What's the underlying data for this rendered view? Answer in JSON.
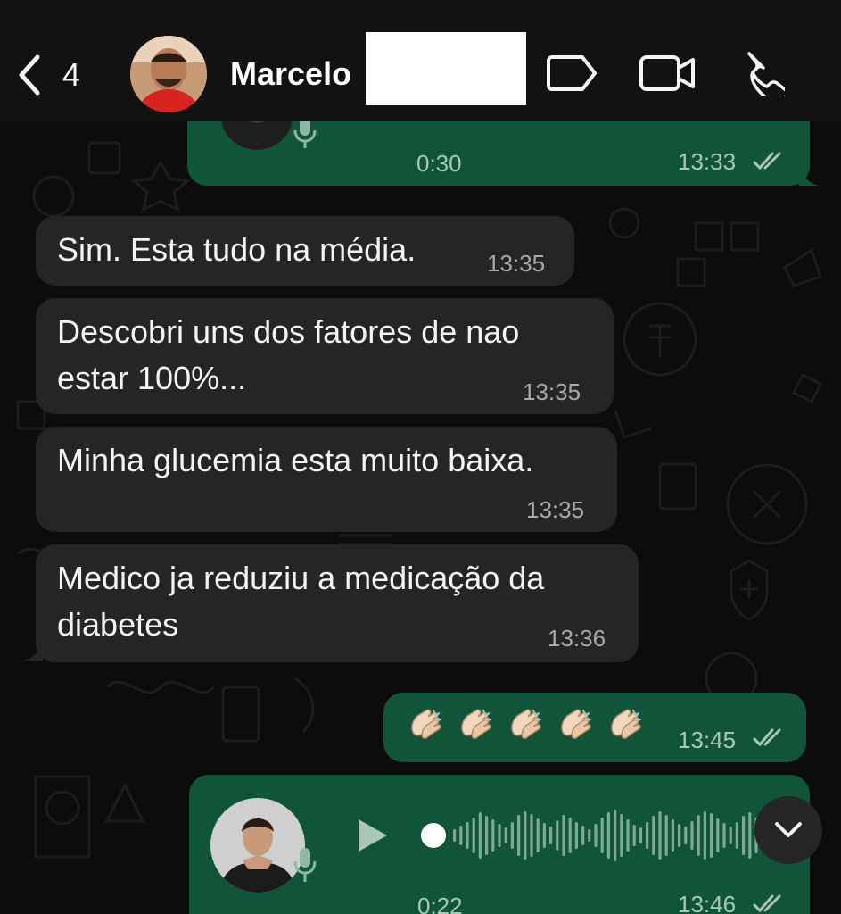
{
  "header": {
    "back_count": "4",
    "contact_name": "Marcelo",
    "icons": [
      "back-chevron-icon",
      "label-icon",
      "video-call-icon",
      "voice-call-icon"
    ]
  },
  "messages": [
    {
      "id": "voice-top",
      "direction": "outgoing",
      "type": "voice",
      "duration": "0:30",
      "time": "13:33",
      "status": "read"
    },
    {
      "id": "m1",
      "direction": "incoming",
      "type": "text",
      "lines": [
        "Sim. Esta tudo na média."
      ],
      "time": "13:35"
    },
    {
      "id": "m2",
      "direction": "incoming",
      "type": "text",
      "lines": [
        "Descobri uns dos fatores de nao",
        "estar 100%..."
      ],
      "time": "13:35"
    },
    {
      "id": "m3",
      "direction": "incoming",
      "type": "text",
      "lines": [
        "Minha glucemia esta muito baixa."
      ],
      "time": "13:35"
    },
    {
      "id": "m4",
      "direction": "incoming",
      "type": "text",
      "lines": [
        "Medico ja reduziu a medicação da",
        "diabetes"
      ],
      "time": "13:36"
    },
    {
      "id": "m5",
      "direction": "outgoing",
      "type": "emoji",
      "emoji_count": 5,
      "emoji": "clapping-hands",
      "time": "13:45",
      "status": "read"
    },
    {
      "id": "voice-bottom",
      "direction": "outgoing",
      "type": "voice",
      "duration": "0:22",
      "time": "13:46",
      "status": "read",
      "progress": 0
    }
  ],
  "colors": {
    "background": "#0c0c0c",
    "header": "#121212",
    "incoming_bubble": "#252525",
    "outgoing_bubble": "#10553a",
    "timestamp": "#a9a9a9"
  }
}
